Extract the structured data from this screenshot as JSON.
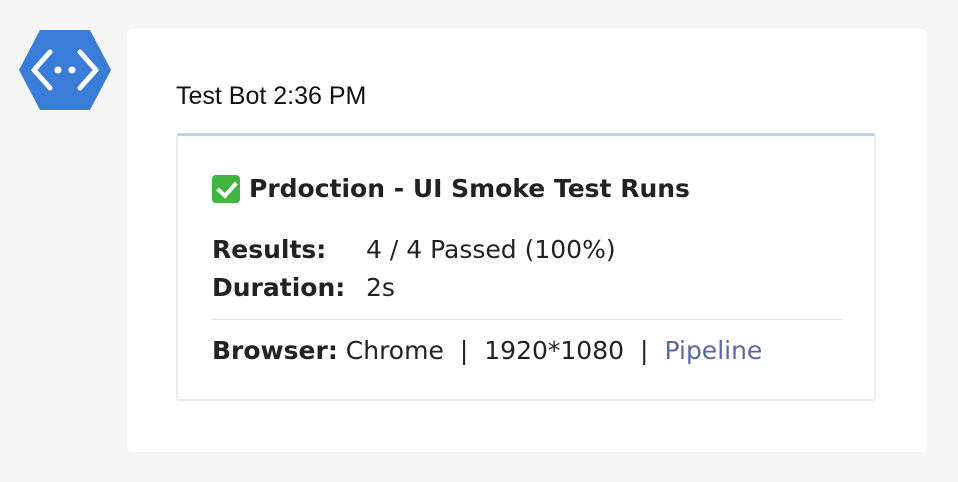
{
  "bot": {
    "name": "Test Bot",
    "time": "2:36 PM",
    "avatar_icon": "bot-hexagon-icon",
    "avatar_color": "#3a7dd8"
  },
  "card": {
    "status_icon": "check-mark-icon",
    "status_color": "#40b53f",
    "accent_color": "#b6d1ec",
    "title": "Prdoction - UI Smoke Test Runs",
    "results_label": "Results:",
    "results_value": "4 / 4 Passed (100%)",
    "duration_label": "Duration:",
    "duration_value": "2s",
    "browser_label": "Browser:",
    "browser_value": "Chrome",
    "separator": "|",
    "resolution": "1920*1080",
    "link_label": "Pipeline",
    "link_color": "#5a6aa0"
  }
}
